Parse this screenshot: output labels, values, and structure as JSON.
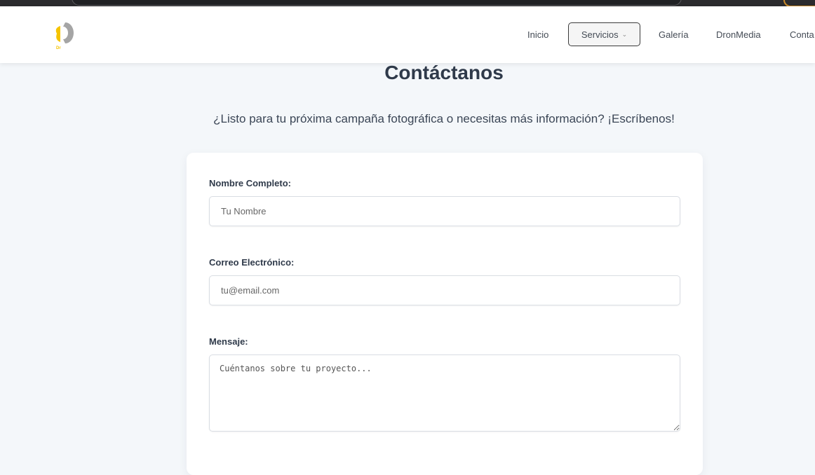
{
  "nav": {
    "logo_text": "Dr",
    "items": [
      {
        "label": "Inicio"
      },
      {
        "label": "Servicios"
      },
      {
        "label": "Galería"
      },
      {
        "label": "DronMedia"
      },
      {
        "label": "Conta"
      }
    ],
    "active_item": "Servicios",
    "services_icon": "chevron-down-icon"
  },
  "page": {
    "title": "Contáctanos",
    "subtitle": "¿Listo para tu próxima campaña fotográfica o necesitas más información? ¡Escríbenos!"
  },
  "form": {
    "name_label": "Nombre Completo:",
    "name_placeholder": "Tu Nombre",
    "email_label": "Correo Electrónico:",
    "email_placeholder": "tu@email.com",
    "message_label": "Mensaje:",
    "message_placeholder": "Cuéntanos sobre tu proyecto..."
  },
  "colors": {
    "page_background": "#f4f7fa",
    "logo_yellow": "#f5c400",
    "logo_gray": "#a5a5a5",
    "text_dark": "#2f3a4a"
  }
}
